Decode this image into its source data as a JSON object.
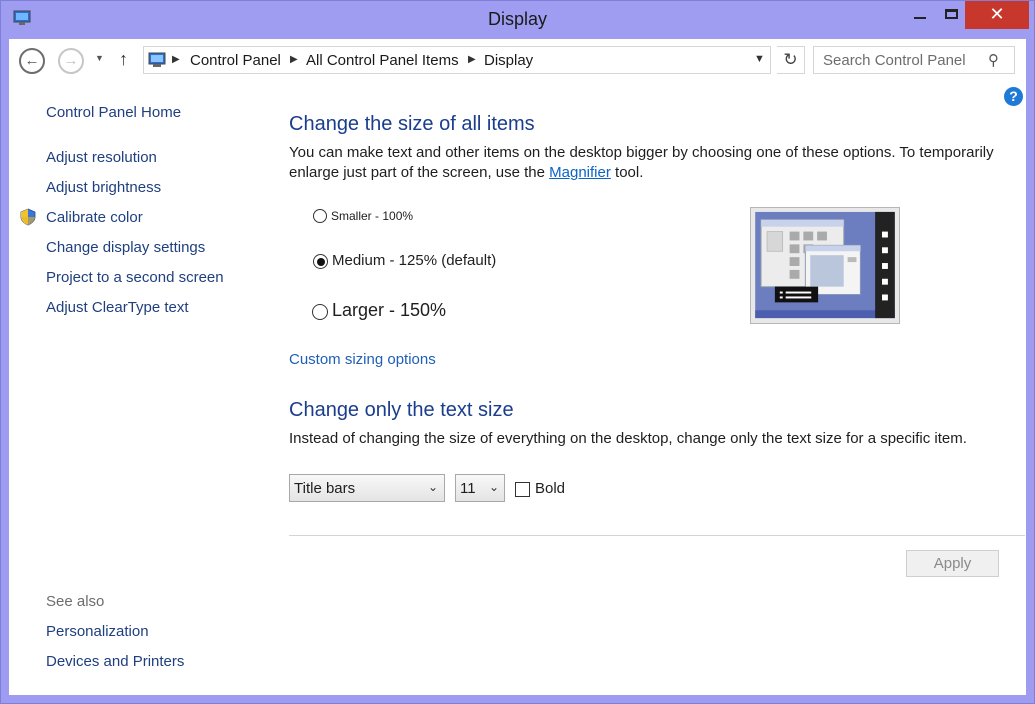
{
  "window": {
    "title": "Display"
  },
  "navbar": {
    "breadcrumb": [
      "Control Panel",
      "All Control Panel Items",
      "Display"
    ],
    "search_placeholder": "Search Control Panel"
  },
  "sidebar": {
    "home": "Control Panel Home",
    "items": [
      {
        "label": "Adjust resolution"
      },
      {
        "label": "Adjust brightness"
      },
      {
        "label": "Calibrate color",
        "icon": "shield-icon"
      },
      {
        "label": "Change display settings"
      },
      {
        "label": "Project to a second screen"
      },
      {
        "label": "Adjust ClearType text"
      }
    ],
    "see_also": "See also",
    "see_also_items": [
      {
        "label": "Personalization"
      },
      {
        "label": "Devices and Printers"
      }
    ]
  },
  "main": {
    "size_heading": "Change the size of all items",
    "size_desc_before": "You can make text and other items on the desktop bigger by choosing one of these options. To temporarily enlarge just part of the screen, use the ",
    "magnifier_link": "Magnifier",
    "size_desc_after": " tool.",
    "size_options": [
      {
        "label": "Smaller - 100%",
        "selected": false
      },
      {
        "label": "Medium - 125% (default)",
        "selected": true
      },
      {
        "label": "Larger - 150%",
        "selected": false
      }
    ],
    "custom_link": "Custom sizing options",
    "text_heading": "Change only the text size",
    "text_desc": "Instead of changing the size of everything on the desktop, change only the text size for a specific item.",
    "item_select": "Title bars",
    "font_size_select": "11",
    "bold_label": "Bold",
    "bold_checked": false,
    "apply_label": "Apply"
  },
  "colors": {
    "titlebar": "#9e9df2",
    "heading": "#1a3d8e",
    "link": "#1f3f7f",
    "close_button": "#c8372c",
    "help_icon": "#1f79d7"
  }
}
